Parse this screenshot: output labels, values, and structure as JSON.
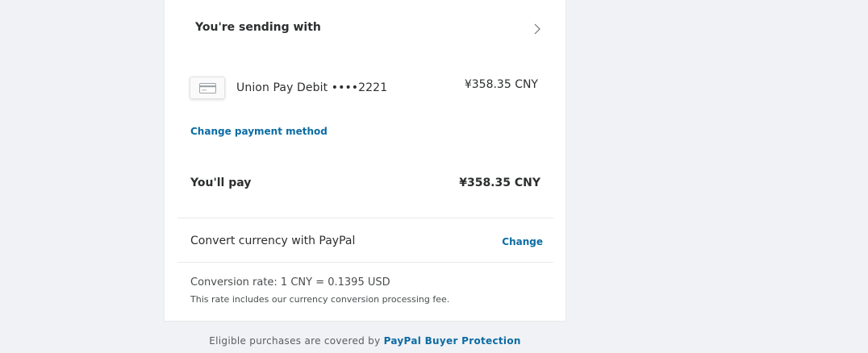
{
  "sending": {
    "title": "You're sending with"
  },
  "payment_method": {
    "name": "Union Pay Debit ••••2221",
    "amount": "¥358.35 CNY",
    "icon": "credit-card-icon"
  },
  "change_payment": {
    "label": "Change payment method"
  },
  "pay": {
    "label": "You'll pay",
    "amount": "¥358.35 CNY"
  },
  "convert": {
    "label": "Convert currency with PayPal",
    "change_label": "Change"
  },
  "conversion": {
    "rate": "Conversion rate: 1 CNY = 0.1395 USD",
    "note": "This rate includes our currency conversion processing fee."
  },
  "footer": {
    "text": "Eligible purchases are covered by ",
    "link": "PayPal Buyer Protection"
  },
  "colors": {
    "link": "#0c6ca4",
    "text": "#2c2e2f",
    "background": "#f1f2f5"
  }
}
